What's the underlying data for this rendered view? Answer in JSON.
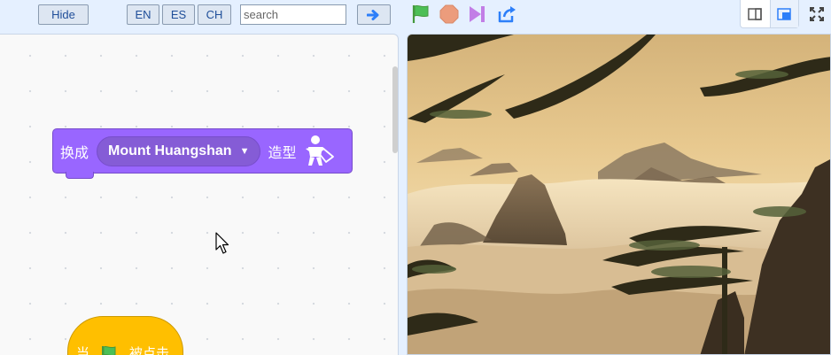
{
  "toolbar": {
    "hide_label": "Hide",
    "languages": [
      "EN",
      "ES",
      "CH"
    ],
    "search_placeholder": "search",
    "go_icon": "arrow-right-icon",
    "controls": [
      "green-flag-icon",
      "stop-icon",
      "step-icon",
      "share-icon"
    ],
    "layout_icons": [
      "small-stage-icon",
      "large-stage-icon"
    ],
    "fullscreen_icon": "fullscreen-icon"
  },
  "code_area": {
    "looks_block": {
      "prefix": "换成",
      "costume": "Mount Huangshan",
      "suffix": "造型",
      "icon": "looks-costume-icon",
      "color": "#9966ff"
    },
    "hat_block": {
      "prefix": "当",
      "suffix": "被点击",
      "icon": "green-flag-icon",
      "color": "#ffbf00"
    }
  },
  "stage": {
    "image": "mount-huangshan-sea-of-clouds"
  },
  "colors": {
    "accent": "#4c97ff",
    "looks": "#9966ff",
    "events": "#ffbf00",
    "flag": "#4cbf56",
    "stop": "#ec9c7c"
  }
}
